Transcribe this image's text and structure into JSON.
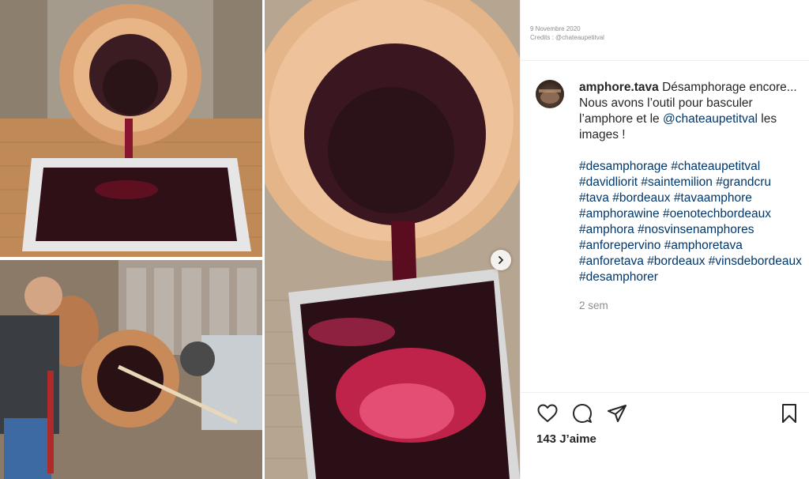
{
  "post": {
    "date": "9 Novembre 2020",
    "credits": "Credits : @chateaupetitval",
    "username": "amphore.tava",
    "caption_start": " Désamphorage encore... Nous avons l’outil pour basculer l’amphore et le ",
    "mention": "@chateaupetitval",
    "caption_end": " les images !",
    "hashtags": [
      "#desamphorage",
      "#chateaupetitval",
      "#davidliorit",
      "#saintemilion",
      "#grandcru",
      "#tava",
      "#bordeaux",
      "#tavaamphore",
      "#amphorawine",
      "#oenotechbordeaux",
      "#amphora",
      "#nosvinsenamphores",
      "#anforepervino",
      "#amphoretava",
      "#anforetava",
      "#bordeaux",
      "#vinsdebordeaux",
      "#desamphorer"
    ],
    "time_ago": "2 sem",
    "likes": "143 J’aime"
  },
  "icons": {
    "like": "heart-icon",
    "comment": "comment-icon",
    "share": "send-icon",
    "save": "bookmark-icon",
    "next": "chevron-right-icon"
  }
}
